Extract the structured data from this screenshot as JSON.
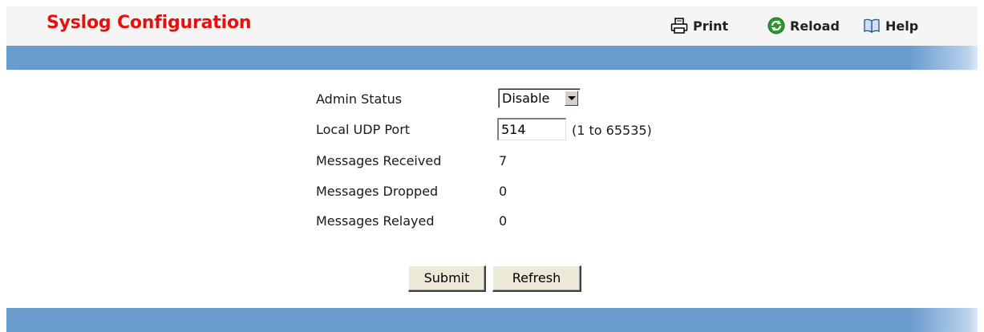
{
  "header": {
    "title": "Syslog Configuration",
    "print_label": "Print",
    "reload_label": "Reload",
    "help_label": "Help"
  },
  "icons": {
    "print": "printer-icon",
    "reload": "reload-icon",
    "help": "book-icon"
  },
  "form": {
    "admin_status": {
      "label": "Admin Status",
      "selected": "Disable"
    },
    "local_udp_port": {
      "label": "Local UDP Port",
      "value": "514",
      "range_hint": "(1 to 65535)"
    },
    "messages_received": {
      "label": "Messages Received",
      "value": "7"
    },
    "messages_dropped": {
      "label": "Messages Dropped",
      "value": "0"
    },
    "messages_relayed": {
      "label": "Messages Relayed",
      "value": "0"
    }
  },
  "buttons": {
    "submit": "Submit",
    "refresh": "Refresh"
  },
  "colors": {
    "title": "#e8100c",
    "bar": "#6a9bcd",
    "panel": "#f5f5f5"
  }
}
